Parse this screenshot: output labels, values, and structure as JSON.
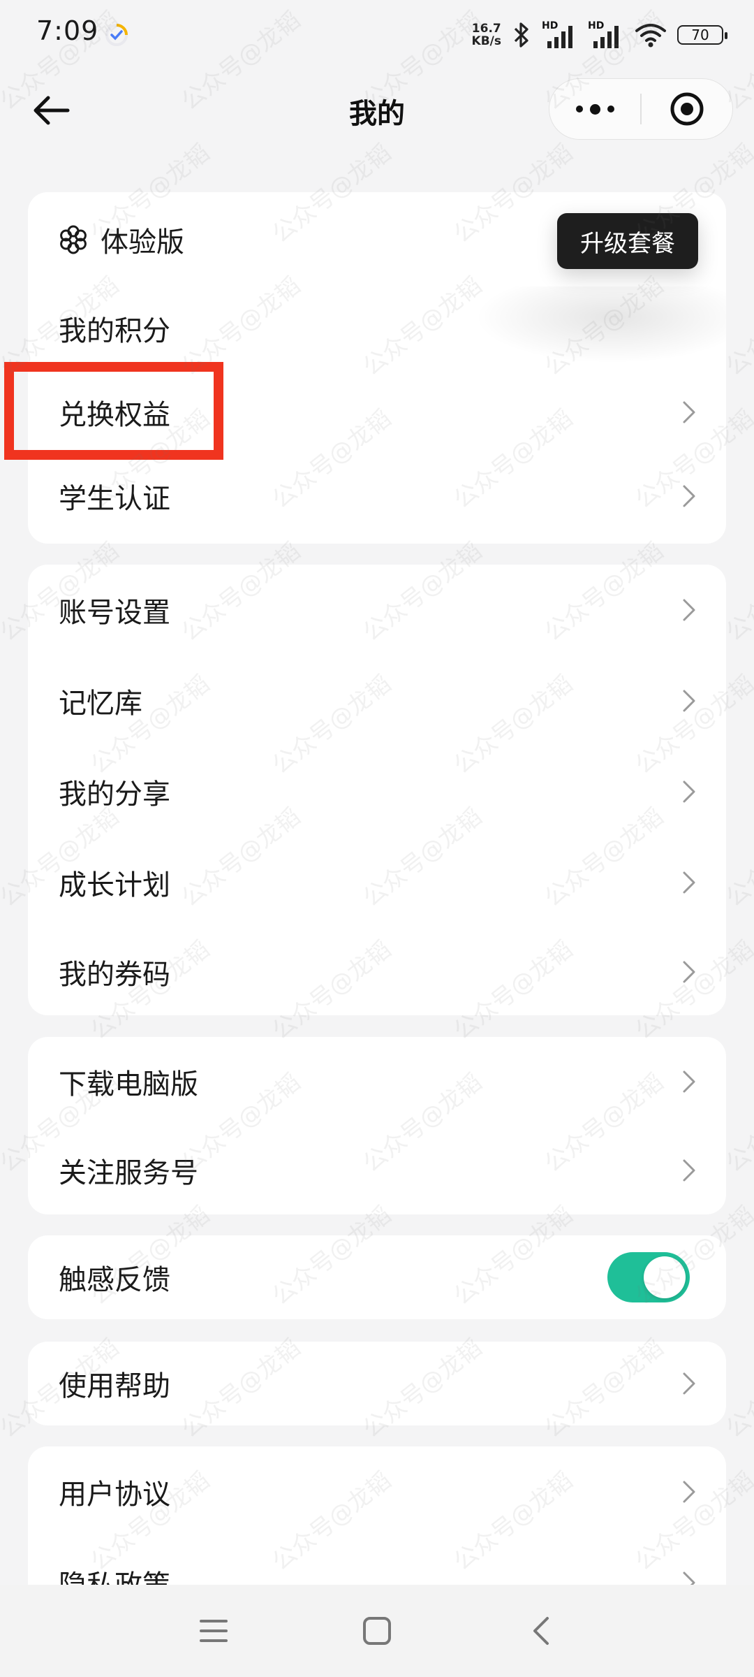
{
  "status_bar": {
    "time": "7:09",
    "net_speed_value": "16.7",
    "net_speed_unit": "KB/s",
    "signal_1_label": "HD",
    "signal_2_label": "HD",
    "battery": "70"
  },
  "header": {
    "title": "我的"
  },
  "plan_card": {
    "plan_name": "体验版",
    "upgrade_label": "升级套餐",
    "items": [
      {
        "label": "我的积分"
      },
      {
        "label": "兑换权益"
      },
      {
        "label": "学生认证"
      }
    ]
  },
  "account_card": {
    "items": [
      {
        "label": "账号设置"
      },
      {
        "label": "记忆库"
      },
      {
        "label": "我的分享"
      },
      {
        "label": "成长计划"
      },
      {
        "label": "我的券码"
      }
    ]
  },
  "download_card": {
    "items": [
      {
        "label": "下载电脑版"
      },
      {
        "label": "关注服务号"
      }
    ]
  },
  "haptic_card": {
    "label": "触感反馈",
    "enabled": true
  },
  "help_card": {
    "label": "使用帮助"
  },
  "legal_card": {
    "items": [
      {
        "label": "用户协议"
      },
      {
        "label": "隐私政策"
      }
    ]
  },
  "watermark": "公众号@龙韬",
  "colors": {
    "accent_toggle": "#1fbf98",
    "highlight_box": "#f0341f",
    "upgrade_button": "#1e1e1e"
  }
}
